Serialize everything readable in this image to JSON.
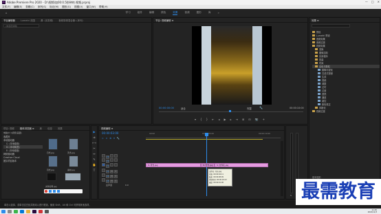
{
  "window": {
    "title": "Adobe Premiere Pro 2020 - D:\\视频\\加00:0.5秒钟的 视频.prproj",
    "controls": [
      "—",
      "□",
      "✕"
    ]
  },
  "menu": [
    "文件(F)",
    "编辑(E)",
    "剪辑(C)",
    "序列(S)",
    "标记(M)",
    "图形(G)",
    "视图(V)",
    "窗口(W)",
    "帮助(H)"
  ],
  "workspaces": {
    "items": [
      "学习",
      "组件",
      "编辑",
      "颜色",
      "效果",
      "音频",
      "图形",
      "库"
    ],
    "active_index": 4
  },
  "source_panel": {
    "tabs": [
      "节目编辑器",
      "Lumetri 范围",
      "源: (无剪辑)",
      "音频剪辑混合器: (序列)"
    ],
    "search_placeholder": "(未选定剪辑)"
  },
  "program_monitor": {
    "tab": "节目: 视频编辑 ≡",
    "timecode_left": "00:00:00:00",
    "fit_label": "适合",
    "quality_label": "完整",
    "timecode_right": "00:00:10:00"
  },
  "effects_panel": {
    "tab": "效果 ≡",
    "items": [
      "预设",
      "Lumetri 预设",
      "音频效果",
      "音频过渡",
      "视频效果",
      "变换",
      "图像控制",
      "实用程序",
      "扭曲",
      "时间",
      "杂色与颗粒",
      "模糊与锐化",
      "沉浸式视频",
      "生成",
      "视频",
      "调整",
      "过时",
      "过渡",
      "透视",
      "通道",
      "键控",
      "颜色校正",
      "风格化",
      "视频过渡"
    ],
    "tabs_bottom": [
      "基本图形",
      "基本声音",
      "Lumetri 颜色",
      "库",
      "标记"
    ]
  },
  "project_panel": {
    "tabs": [
      "项目: 视频",
      "媒体浏览器 ≡",
      "库",
      "信息",
      "效果"
    ],
    "path_label": "电脑(D:)\\视频\\画面\\",
    "tree": [
      "收藏夹",
      "本地驱动器",
      "C: (本地磁盘)",
      "D: (本地磁盘)",
      "E: (本地磁盘)",
      "网络驱动器",
      "Creative Cloud",
      "团队项目版本"
    ],
    "thumbs": [
      "日光.jpg",
      "天光.jpg",
      "月光.jpg",
      "素材.jpg",
      "文件名称.jpg"
    ]
  },
  "timeline": {
    "tab": "视频编辑 ≡",
    "timecode": "00:00:03:00",
    "tracks_video": [
      "V3",
      "V2",
      "V1"
    ],
    "tracks_audio": [
      "A1",
      "A2",
      "A3"
    ],
    "master_label": "主声道",
    "master_value": "0.0",
    "clip1": "fx 月光.jpg",
    "clip2": "fx 天光.jpg",
    "clip3": "fx 文件名.jpg",
    "tooltip": [
      "文件名: 月光.jpg",
      "开始: 00:00:04:11",
      "结束: 00:00:08:09",
      "持续时间: 00:00:03:23",
      "速度: 00:00:01:08"
    ],
    "ruler": [
      "00:00",
      "00:00:05:00",
      "00:00:10:00"
    ]
  },
  "status_bar": {
    "text": "单击以选择，或单击空白处并拖动以进行框选。使用 Shift、Alt 和 Ctrl 可获得其他选项。"
  },
  "watermark": "最需教育",
  "taskbar": {
    "time": "11:45",
    "date": "2021/11/3"
  }
}
